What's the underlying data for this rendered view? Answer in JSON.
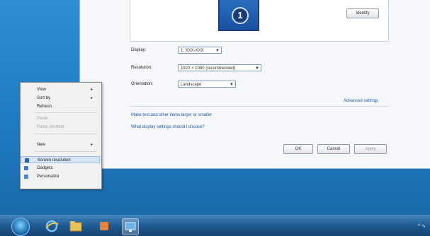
{
  "window": {
    "identify_label": "Identify",
    "display_label": "Display:",
    "display_value": "1. XXX-XXX",
    "resolution_label": "Resolution:",
    "resolution_value": "1920 × 1080 (recommended)",
    "orientation_label": "Orientation:",
    "orientation_value": "Landscape",
    "advanced_link": "Advanced settings",
    "link_text_size": "Make text and other items larger or smaller",
    "link_display_settings": "What display settings should I choose?",
    "ok_label": "OK",
    "cancel_label": "Cancel",
    "apply_label": "Apply",
    "monitor_number": "1"
  },
  "context_menu": {
    "items": [
      {
        "label": "View",
        "has_submenu": true
      },
      {
        "label": "Sort by",
        "has_submenu": true
      },
      {
        "label": "Refresh",
        "has_submenu": false
      },
      {
        "label": "Paste",
        "disabled": true
      },
      {
        "label": "Paste shortcut",
        "disabled": true
      },
      {
        "label": "New",
        "has_submenu": true
      },
      {
        "label": "Screen resolution",
        "selected": true
      },
      {
        "label": "Gadgets"
      },
      {
        "label": "Personalize"
      }
    ]
  },
  "taskbar": {
    "tray_text": "^ ∿"
  },
  "colors": {
    "desktop": "#1f7cc4",
    "taskbar": "#1e5990",
    "link": "#1f5fb0",
    "menu_highlight": "#d6e6f6"
  }
}
